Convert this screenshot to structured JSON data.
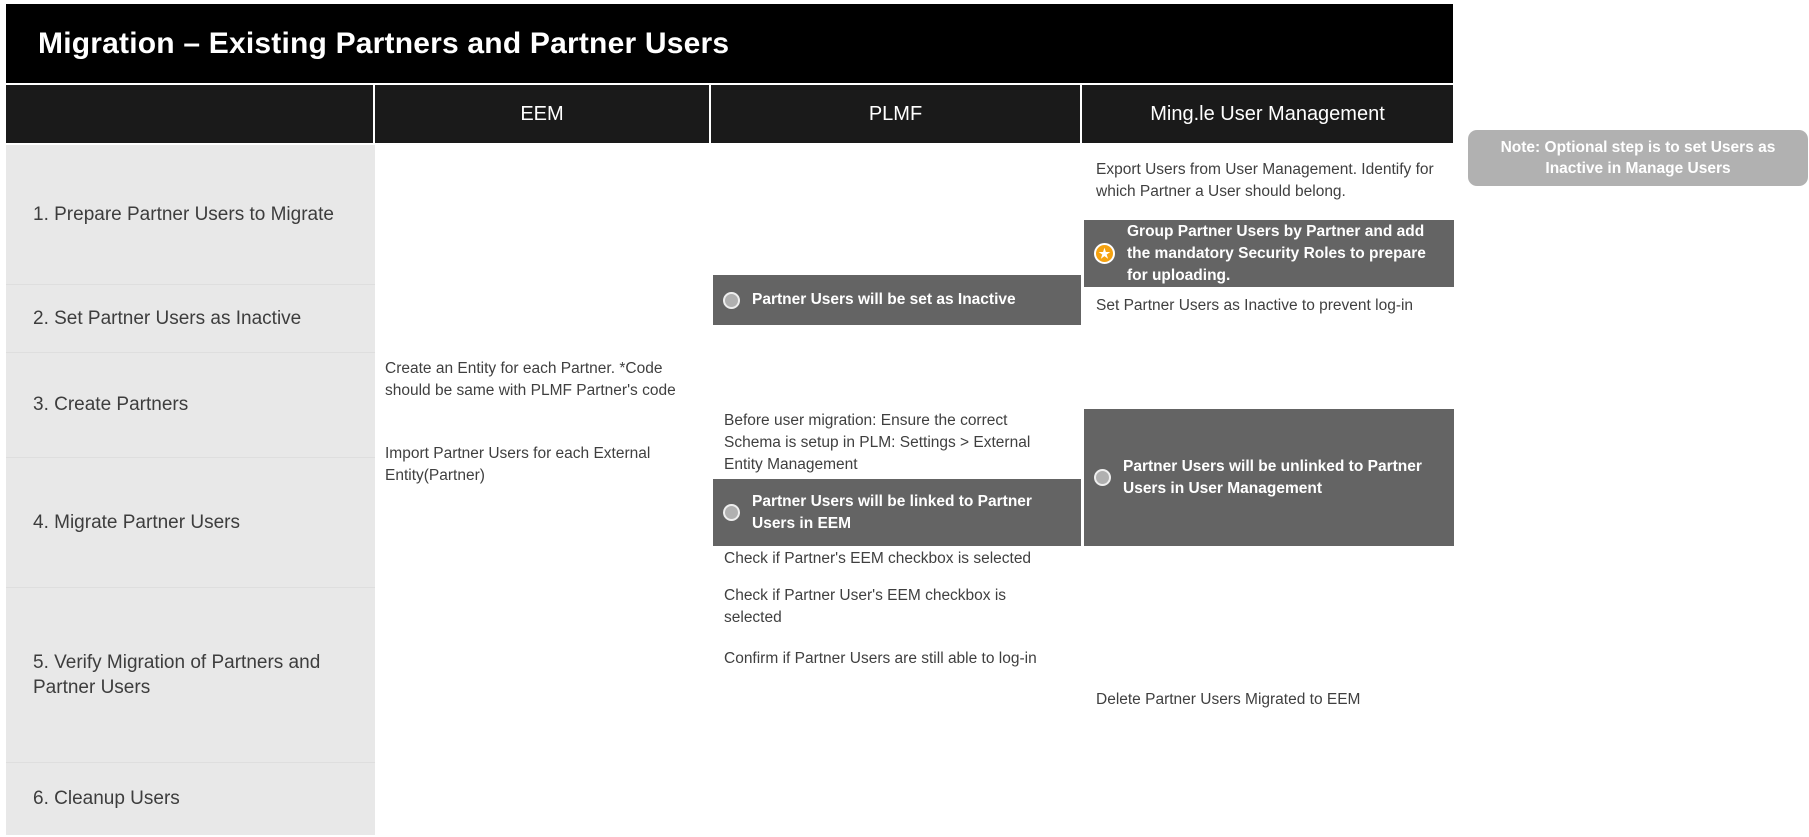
{
  "slide": {
    "title": "Migration – Existing Partners and Partner Users"
  },
  "table": {
    "headers": {
      "steps": "",
      "eem": "EEM",
      "plmf": "PLMF",
      "mingle": "Ming.le User Management"
    },
    "steps": [
      {
        "label": "1. Prepare Partner Users to Migrate"
      },
      {
        "label": "2. Set Partner Users as Inactive"
      },
      {
        "label": "3. Create Partners"
      },
      {
        "label": "4. Migrate Partner Users"
      },
      {
        "label": "5. Verify Migration of Partners and Partner Users"
      },
      {
        "label": "6. Cleanup Users"
      }
    ],
    "cells": {
      "mingle_export_users": "Export Users from User Management. Identify for which Partner a User should belong.",
      "mingle_group_users": "Group Partner Users by Partner and add the mandatory Security Roles to prepare for uploading.",
      "plmf_set_inactive": "Partner Users will be set as Inactive",
      "mingle_set_inactive": "Set Partner Users as Inactive to prevent log-in",
      "eem_create_entity": "Create an Entity for each Partner. *Code should be same with PLMF Partner's code",
      "eem_import_users": "Import Partner Users for each External Entity(Partner)",
      "plmf_schema_setup": "Before user migration: Ensure the correct Schema is setup in PLM: Settings > External Entity Management",
      "plmf_linked_users": "Partner Users will be linked to Partner Users in EEM",
      "mingle_unlinked_users": "Partner Users will be unlinked to Partner Users in User Management",
      "plmf_verify_partner_checkbox": "Check if Partner's EEM checkbox is selected",
      "plmf_verify_user_checkbox": "Check if Partner User's EEM checkbox is selected",
      "plmf_verify_login": "Confirm if Partner Users are still able to log-in",
      "mingle_delete_users": "Delete Partner Users Migrated to EEM"
    }
  },
  "side_note": {
    "text": "Note: Optional step is to set Users as Inactive in Manage Users"
  },
  "icons": {
    "star": "★"
  },
  "colors": {
    "title_bar": "#000000",
    "header_cell": "#1a1a1a",
    "step_cell": "#e8e8e8",
    "dark_box": "#646464",
    "star_badge": "#f5a210",
    "side_note": "#b1b1b1"
  }
}
